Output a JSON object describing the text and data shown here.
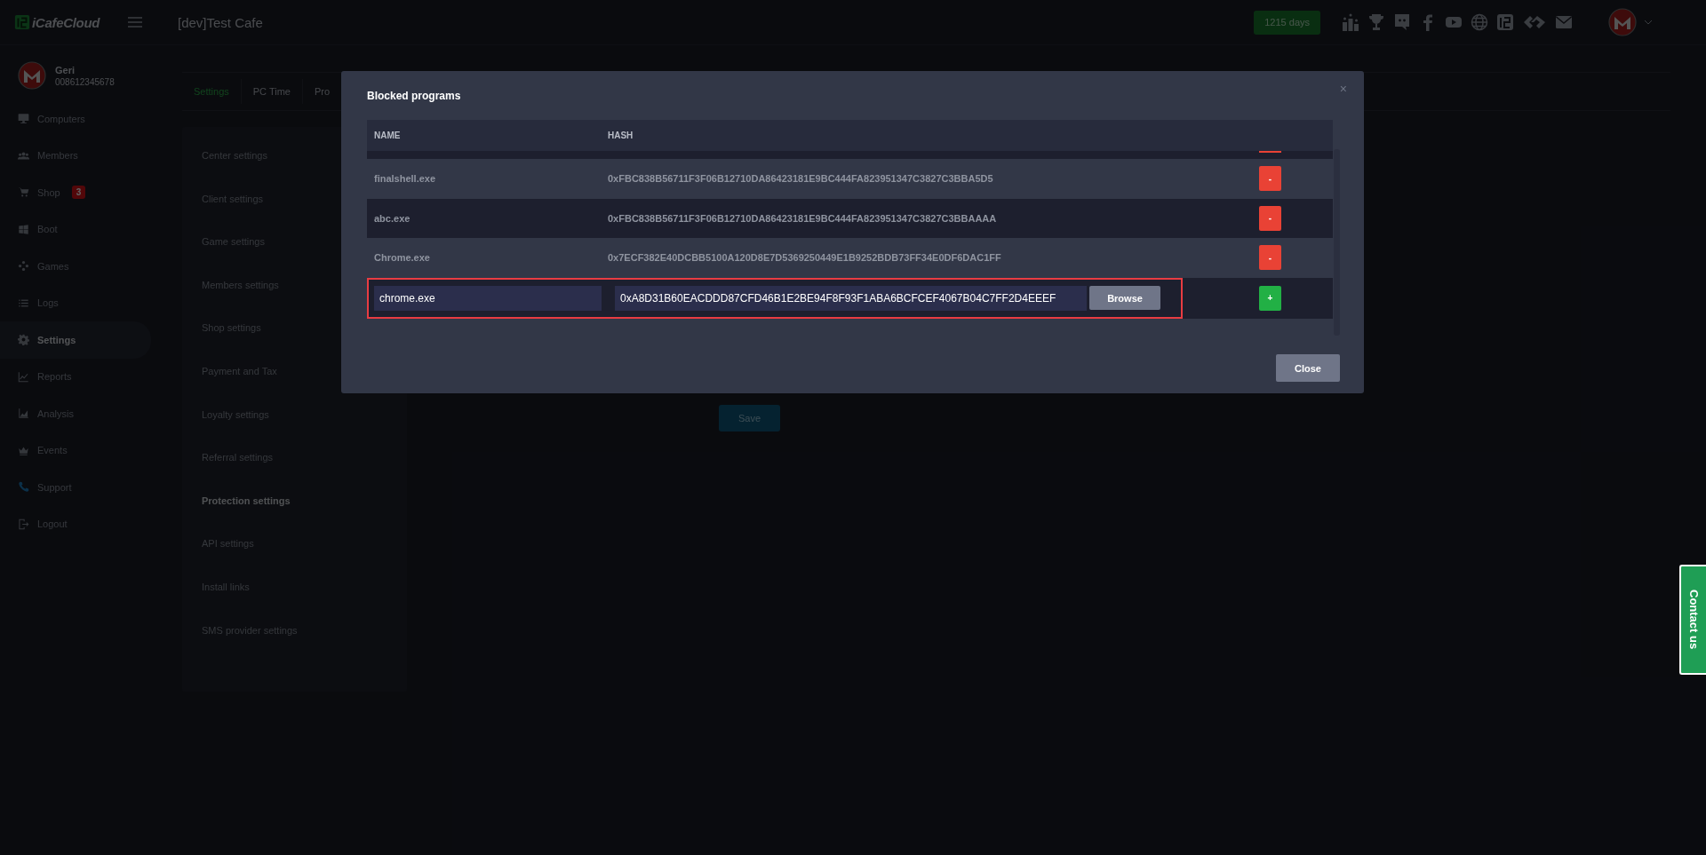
{
  "topbar": {
    "logo": "iCafeCloud",
    "cafe_name": "[dev]Test Cafe",
    "days_badge": "1215 days"
  },
  "sidebar": {
    "user": {
      "name": "Geri",
      "phone": "008612345678"
    },
    "items": [
      {
        "label": "Computers",
        "selected": false
      },
      {
        "label": "Members",
        "selected": false
      },
      {
        "label": "Shop",
        "selected": false,
        "badge": "3"
      },
      {
        "label": "Boot",
        "selected": false
      },
      {
        "label": "Games",
        "selected": false
      },
      {
        "label": "Logs",
        "selected": false
      },
      {
        "label": "Settings",
        "selected": true
      },
      {
        "label": "Reports",
        "selected": false
      },
      {
        "label": "Analysis",
        "selected": false
      },
      {
        "label": "Events",
        "selected": false
      },
      {
        "label": "Support",
        "selected": false
      },
      {
        "label": "Logout",
        "selected": false
      }
    ]
  },
  "tabs": [
    {
      "label": "Settings",
      "selected": true
    },
    {
      "label": "PC Time",
      "selected": false
    },
    {
      "label": "Pro",
      "selected": false
    }
  ],
  "settings_menu": [
    {
      "label": "Center settings",
      "selected": false
    },
    {
      "label": "Client settings",
      "selected": false
    },
    {
      "label": "Game settings",
      "selected": false
    },
    {
      "label": "Members settings",
      "selected": false
    },
    {
      "label": "Shop settings",
      "selected": false
    },
    {
      "label": "Payment and Tax",
      "selected": false
    },
    {
      "label": "Loyalty settings",
      "selected": false
    },
    {
      "label": "Referral settings",
      "selected": false
    },
    {
      "label": "Protection settings",
      "selected": true
    },
    {
      "label": "API settings",
      "selected": false
    },
    {
      "label": "Install links",
      "selected": false
    },
    {
      "label": "SMS provider settings",
      "selected": false
    }
  ],
  "save_button": "Save",
  "modal": {
    "title": "Blocked programs",
    "close_icon": "×",
    "columns": [
      "NAME",
      "HASH"
    ],
    "rows": [
      {
        "name": "finalshell.exe",
        "hash": "0xFBC838B56711F3F06B12710DA86423181E9BC444FA823951347C3827C3BBA5D5",
        "button": "-"
      },
      {
        "name": "abc.exe",
        "hash": "0xFBC838B56711F3F06B12710DA86423181E9BC444FA823951347C3827C3BBAAAA",
        "button": "-"
      },
      {
        "name": "Chrome.exe",
        "hash": "0x7ECF382E40DCBB5100A120D8E7D5369250449E1B9252BDB73FF34E0DF6DAC1FF",
        "button": "-"
      }
    ],
    "new_row": {
      "name": "chrome.exe",
      "hash": "0xA8D31B60EACDDD87CFD46B1E2BE94F8F93F1ABA6BCFCEF4067B04C7FF2D4EEEF",
      "browse": "Browse",
      "button": "+"
    },
    "close": "Close"
  },
  "contact": "Contact us"
}
